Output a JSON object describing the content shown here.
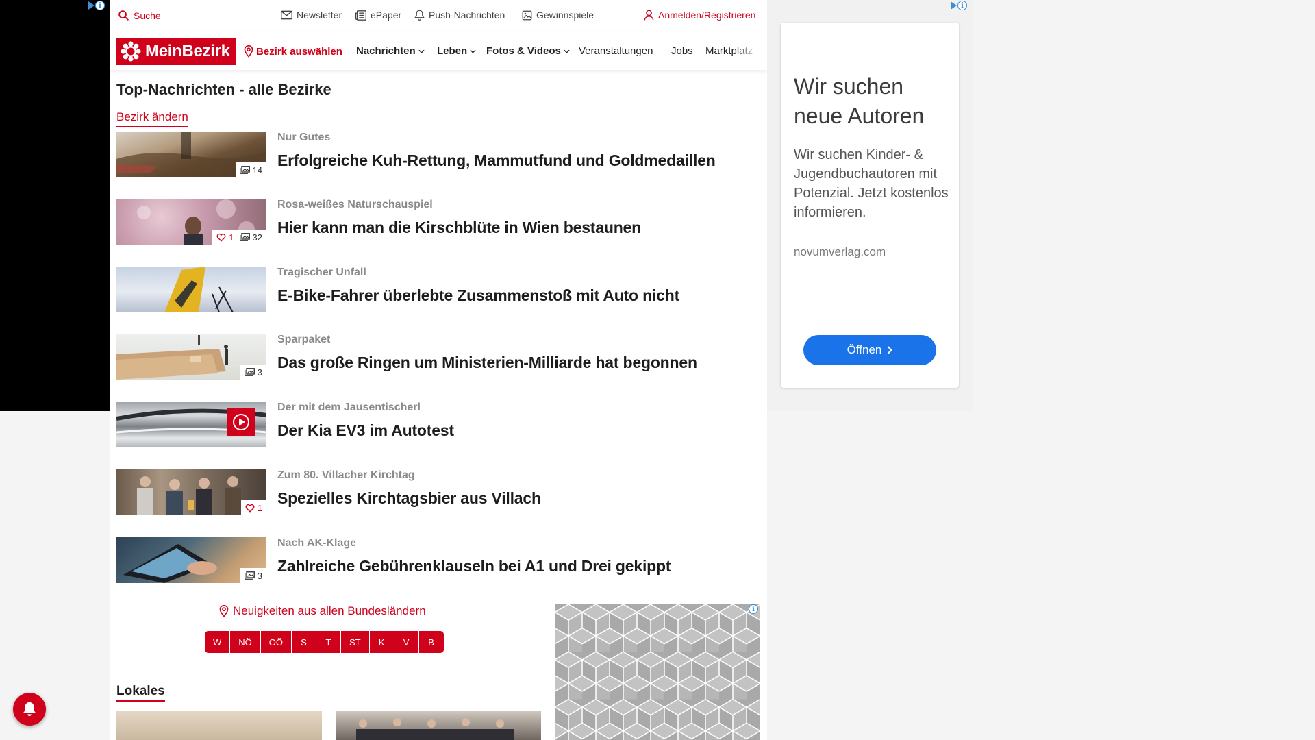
{
  "utility_bar": {
    "search_label": "Suche",
    "newsletter_label": "Newsletter",
    "epaper_label": "ePaper",
    "push_label": "Push-Nachrichten",
    "gewinnspiele_label": "Gewinnspiele",
    "login_label": "Anmelden/Registrieren"
  },
  "navigation": {
    "logo_text": "MeinBezirk",
    "bezirk_label": "Bezirk auswählen",
    "items": [
      {
        "label": "Nachrichten"
      },
      {
        "label": "Leben"
      },
      {
        "label": "Fotos & Videos"
      },
      {
        "label": "Veranstaltungen"
      },
      {
        "label": "Jobs"
      },
      {
        "label": "Marktplatz"
      }
    ]
  },
  "main": {
    "section_title": "Top-Nachrichten - alle Bezirke",
    "change_link": "Bezirk ändern",
    "articles": [
      {
        "kicker": "Nur Gutes",
        "headline": "Erfolgreiche Kuh-Rettung, Mammutfund und Goldmedaillen",
        "photos": "14",
        "likes": ""
      },
      {
        "kicker": "Rosa-weißes Naturschauspiel",
        "headline": "Hier kann man die Kirschblüte in Wien bestaunen",
        "photos": "32",
        "likes": "1"
      },
      {
        "kicker": "Tragischer Unfall",
        "headline": "E-Bike-Fahrer überlebte Zusammenstoß mit Auto nicht",
        "photos": "",
        "likes": ""
      },
      {
        "kicker": "Sparpaket",
        "headline": "Das große Ringen um Ministerien-Milliarde hat begonnen",
        "photos": "3",
        "likes": ""
      },
      {
        "kicker": "Der mit dem Jausentischerl",
        "headline": "Der Kia EV3 im Autotest",
        "photos": "",
        "likes": "",
        "video": true
      },
      {
        "kicker": "Zum 80. Villacher Kirchtag",
        "headline": "Spezielles Kirchtagsbier aus Villach",
        "photos": "",
        "likes": "1"
      },
      {
        "kicker": "Nach AK-Klage",
        "headline": "Zahlreiche Gebührenklauseln bei A1 und Drei gekippt",
        "photos": "3",
        "likes": ""
      }
    ],
    "states_link": "Neuigkeiten aus allen Bundesländern",
    "states": [
      "W",
      "NÖ",
      "OÖ",
      "S",
      "T",
      "ST",
      "K",
      "V",
      "B"
    ],
    "lokales_title": "Lokales"
  },
  "right_ad": {
    "headline": "Wir suchen neue Autoren",
    "body": "Wir suchen Kinder- & Jugendbuchautoren mit Potenzial. Jetzt kostenlos informieren.",
    "domain": "novumverlag.com",
    "button_label": "Öffnen"
  },
  "colors": {
    "brand_red": "#d0021b",
    "ad_blue": "#1a73e8"
  }
}
